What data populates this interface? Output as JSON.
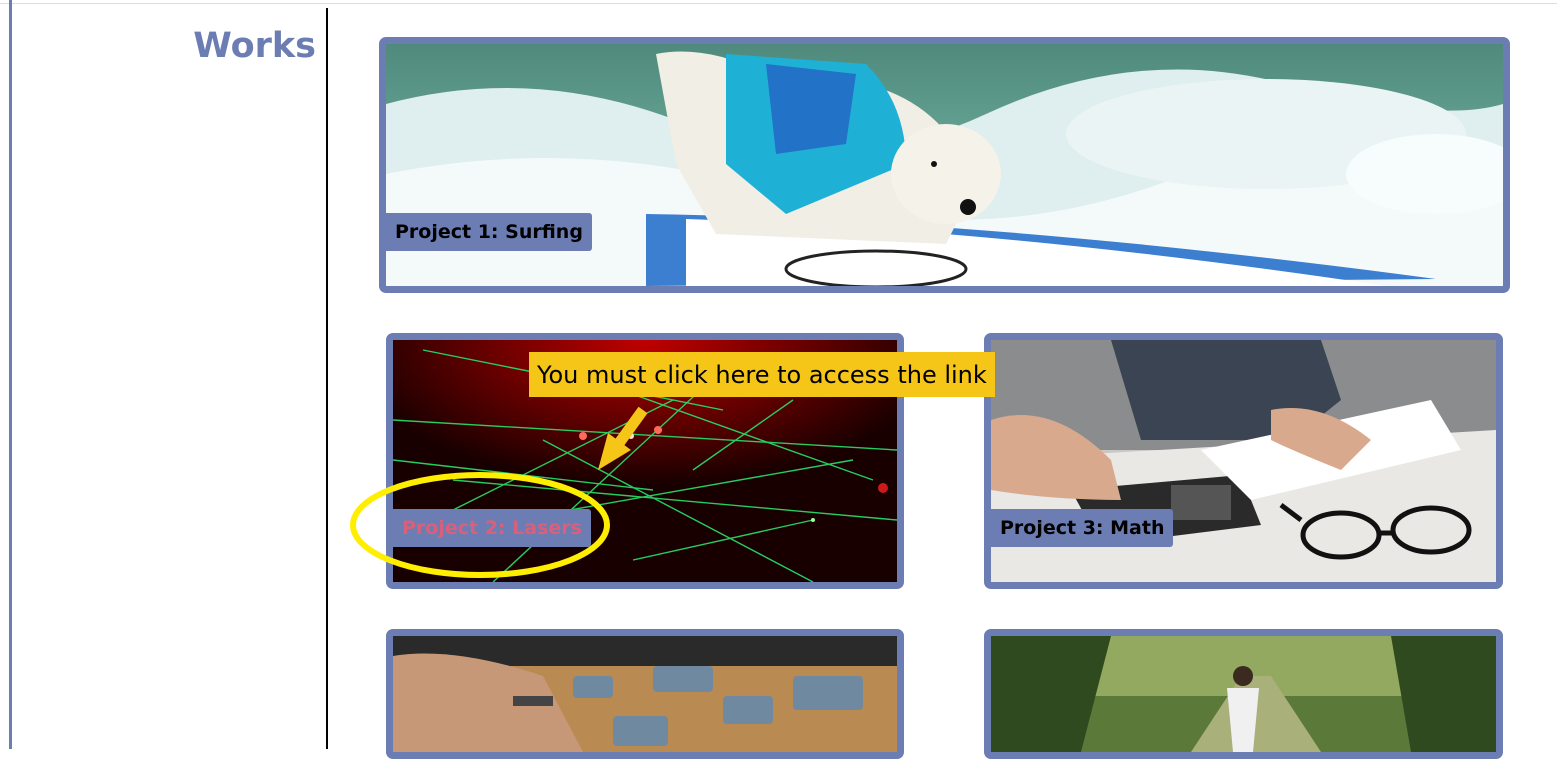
{
  "section": {
    "title": "Works"
  },
  "projects": [
    {
      "label": "Project 1: Surfing",
      "image": "dog surfing on a board"
    },
    {
      "label": "Project 2: Lasers",
      "image": "green laser beams"
    },
    {
      "label": "Project 3: Math",
      "image": "hands using a calculator"
    },
    {
      "label": "",
      "image": "hands assembling a jigsaw puzzle"
    },
    {
      "label": "",
      "image": "runner on a forest path"
    }
  ],
  "annotation": {
    "callout_text": "You must click here to access the link",
    "highlight_color": "#ffee00",
    "callout_color": "#f5c518",
    "arrow_icon": "arrow-down-left-icon"
  },
  "colors": {
    "accent": "#6b7db3",
    "link_visited": "#d9607a"
  }
}
